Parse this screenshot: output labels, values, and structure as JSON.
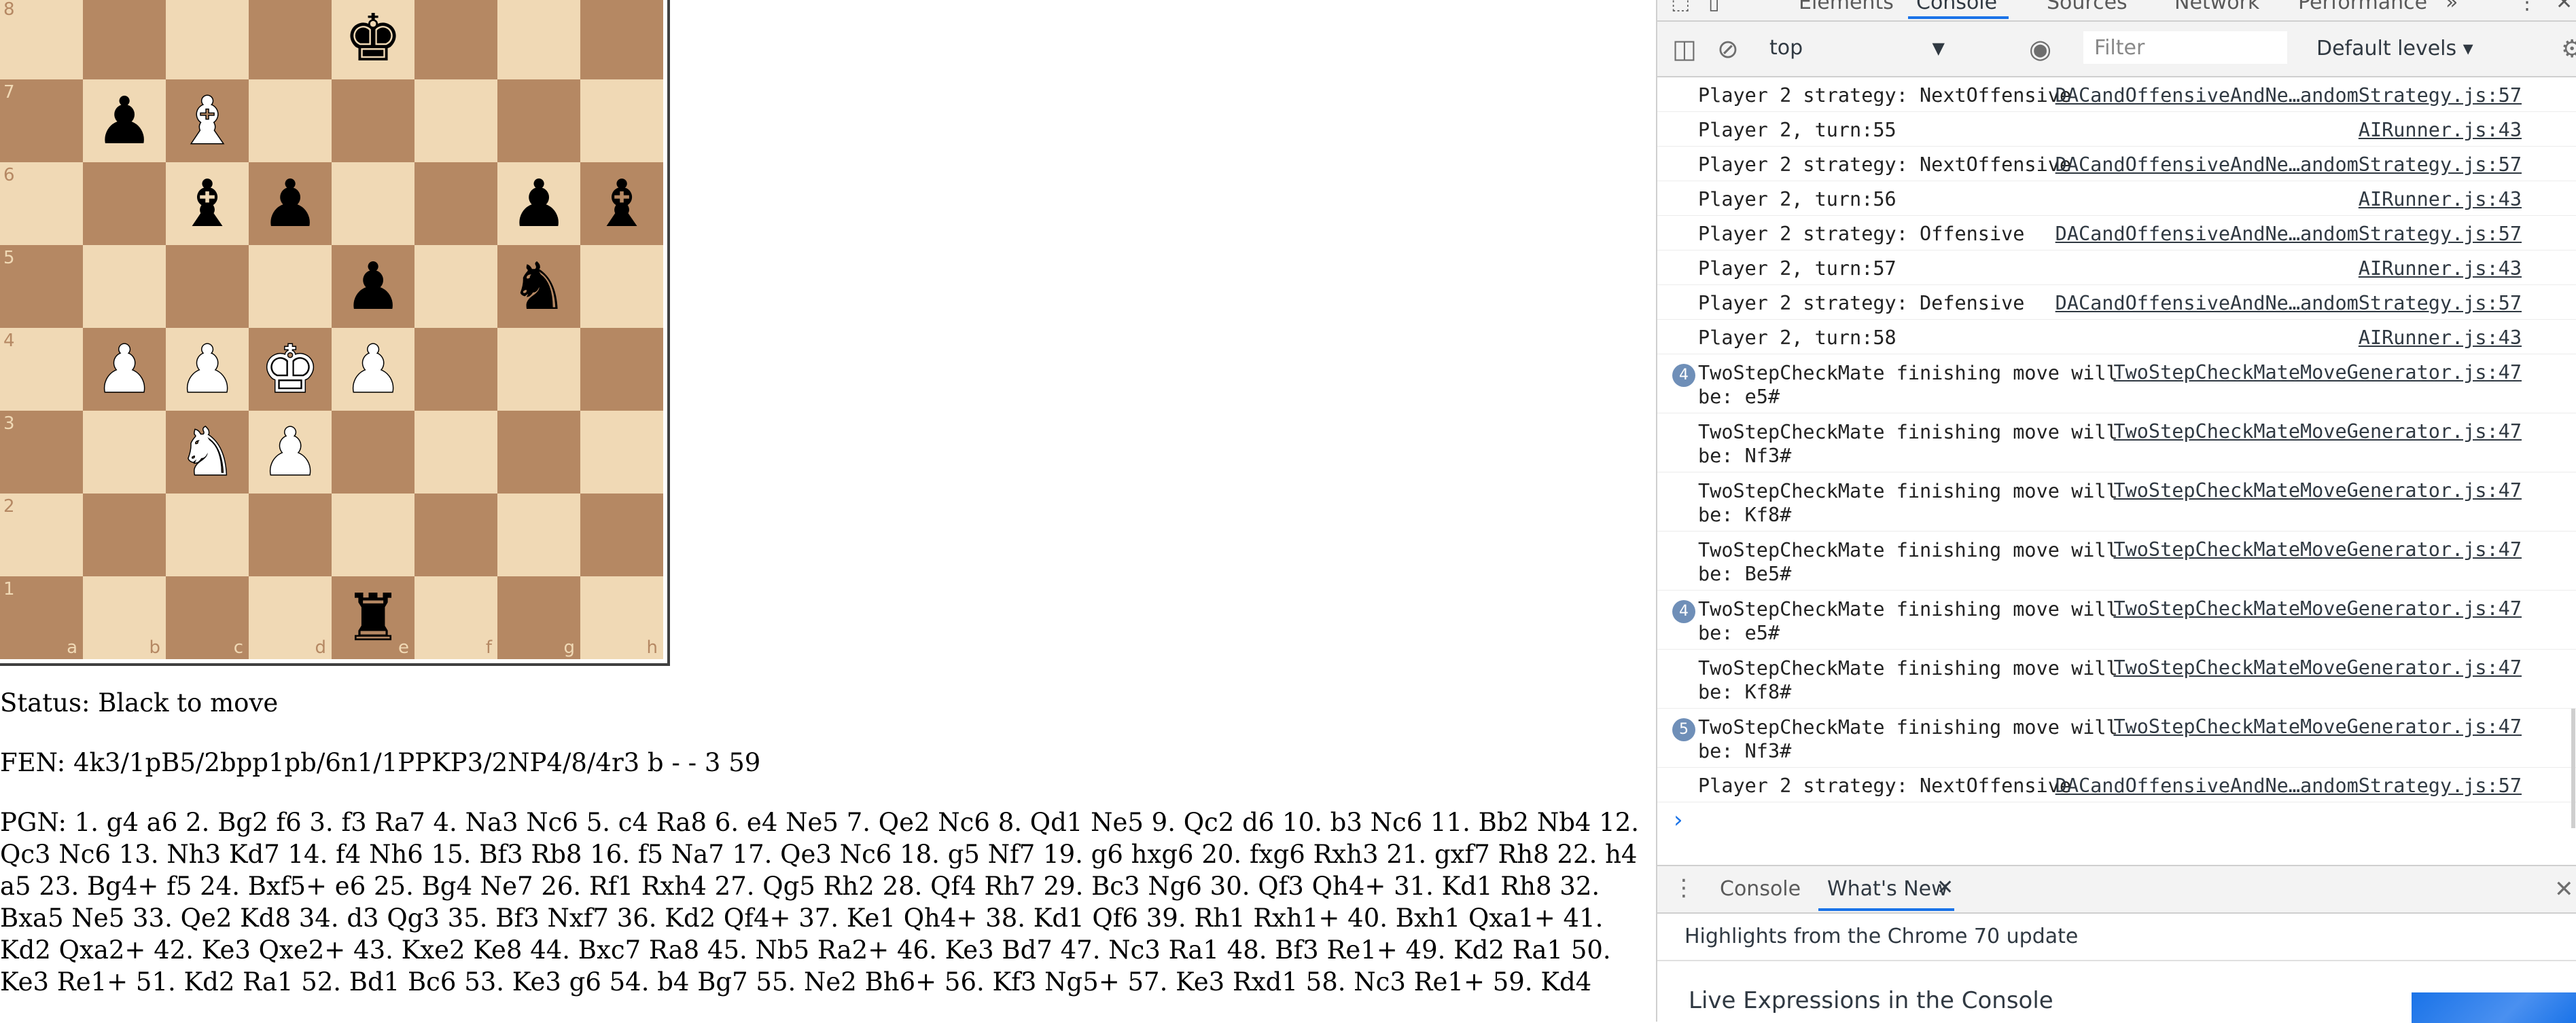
{
  "board": {
    "files": [
      "a",
      "b",
      "c",
      "d",
      "e",
      "f",
      "g",
      "h"
    ],
    "ranks": [
      "8",
      "7",
      "6",
      "5",
      "4",
      "3",
      "2",
      "1"
    ],
    "pieces": [
      {
        "square": "e8",
        "color": "black",
        "type": "king",
        "glyph": "♚"
      },
      {
        "square": "b7",
        "color": "black",
        "type": "pawn",
        "glyph": "♟"
      },
      {
        "square": "c7",
        "color": "white",
        "type": "bishop",
        "glyph": "♝"
      },
      {
        "square": "c6",
        "color": "black",
        "type": "bishop",
        "glyph": "♝"
      },
      {
        "square": "d6",
        "color": "black",
        "type": "pawn",
        "glyph": "♟"
      },
      {
        "square": "g6",
        "color": "black",
        "type": "pawn",
        "glyph": "♟"
      },
      {
        "square": "h6",
        "color": "black",
        "type": "bishop",
        "glyph": "♝"
      },
      {
        "square": "e5",
        "color": "black",
        "type": "pawn",
        "glyph": "♟"
      },
      {
        "square": "g5",
        "color": "black",
        "type": "knight",
        "glyph": "♞"
      },
      {
        "square": "b4",
        "color": "white",
        "type": "pawn",
        "glyph": "♟"
      },
      {
        "square": "c4",
        "color": "white",
        "type": "pawn",
        "glyph": "♟"
      },
      {
        "square": "d4",
        "color": "white",
        "type": "king",
        "glyph": "♚"
      },
      {
        "square": "e4",
        "color": "white",
        "type": "pawn",
        "glyph": "♟"
      },
      {
        "square": "c3",
        "color": "white",
        "type": "knight",
        "glyph": "♞"
      },
      {
        "square": "d3",
        "color": "white",
        "type": "pawn",
        "glyph": "♟"
      },
      {
        "square": "e1",
        "color": "black",
        "type": "rook",
        "glyph": "♜"
      }
    ],
    "light_color": "#f0d9b5",
    "dark_color": "#b58863"
  },
  "game": {
    "status": "Status: Black to move",
    "fen": "FEN: 4k3/1pB5/2bpp1pb/6n1/1PPKP3/2NP4/8/4r3 b - - 3 59",
    "pgn": "PGN: 1. g4 a6 2. Bg2 f6 3. f3 Ra7 4. Na3 Nc6 5. c4 Ra8 6. e4 Ne5 7. Qe2 Nc6 8. Qd1 Ne5 9. Qc2 d6 10. b3 Nc6 11. Bb2 Nb4 12. Qc3 Nc6 13. Nh3 Kd7 14. f4 Nh6 15. Bf3 Rb8 16. f5 Na7 17. Qe3 Nc6 18. g5 Nf7 19. g6 hxg6 20. fxg6 Rxh3 21. gxf7 Rh8 22. h4 a5 23. Bg4+ f5 24. Bxf5+ e6 25. Bg4 Ne7 26. Rf1 Rxh4 27. Qg5 Rh2 28. Qf4 Rh7 29. Bc3 Ng6 30. Qf3 Qh4+ 31. Kd1 Rh8 32. Bxa5 Ne5 33. Qe2 Kd8 34. d3 Qg3 35. Bf3 Nxf7 36. Kd2 Qf4+ 37. Ke1 Qh4+ 38. Kd1 Qf6 39. Rh1 Rxh1+ 40. Bxh1 Qxa1+ 41. Kd2 Qxa2+ 42. Ke3 Qxe2+ 43. Kxe2 Ke8 44. Bxc7 Ra8 45. Nb5 Ra2+ 46. Ke3 Bd7 47. Nc3 Ra1 48. Bf3 Re1+ 49. Kd2 Ra1 50. Ke3 Re1+ 51. Kd2 Ra1 52. Bd1 Bc6 53. Ke3 g6 54. b4 Bg7 55. Ne2 Bh6+ 56. Kf3 Ng5+ 57. Ke3 Rxd1 58. Nc3 Re1+ 59. Kd4"
  },
  "devtools": {
    "tabs": [
      {
        "label": "Elements",
        "active": false
      },
      {
        "label": "Console",
        "active": true
      },
      {
        "label": "Sources",
        "active": false
      },
      {
        "label": "Network",
        "active": false
      },
      {
        "label": "Performance",
        "active": false
      }
    ],
    "more_tabs_icon": "»",
    "menu_icon": "⋮",
    "close_icon": "✕",
    "toolbar": {
      "context": "top",
      "filter_placeholder": "Filter",
      "levels": "Default levels ▾"
    },
    "messages": [
      {
        "text": "Player 2 strategy: NextOffensive",
        "source": "DACandOffensiveAndNe…andomStrategy.js:57"
      },
      {
        "text": "Player 2, turn:55",
        "source": "AIRunner.js:43"
      },
      {
        "text": "Player 2 strategy: NextOffensive",
        "source": "DACandOffensiveAndNe…andomStrategy.js:57"
      },
      {
        "text": "Player 2, turn:56",
        "source": "AIRunner.js:43"
      },
      {
        "text": "Player 2 strategy: Offensive",
        "source": "DACandOffensiveAndNe…andomStrategy.js:57"
      },
      {
        "text": "Player 2, turn:57",
        "source": "AIRunner.js:43"
      },
      {
        "text": "Player 2 strategy: Defensive",
        "source": "DACandOffensiveAndNe…andomStrategy.js:57"
      },
      {
        "text": "Player 2, turn:58",
        "source": "AIRunner.js:43"
      },
      {
        "text": "TwoStepCheckMate finishing move will\nbe: e5#",
        "source": "TwoStepCheckMateMoveGenerator.js:47",
        "count": "4"
      },
      {
        "text": "TwoStepCheckMate finishing move will\nbe: Nf3#",
        "source": "TwoStepCheckMateMoveGenerator.js:47"
      },
      {
        "text": "TwoStepCheckMate finishing move will\nbe: Kf8#",
        "source": "TwoStepCheckMateMoveGenerator.js:47"
      },
      {
        "text": "TwoStepCheckMate finishing move will\nbe: Be5#",
        "source": "TwoStepCheckMateMoveGenerator.js:47"
      },
      {
        "text": "TwoStepCheckMate finishing move will\nbe: e5#",
        "source": "TwoStepCheckMateMoveGenerator.js:47",
        "count": "4"
      },
      {
        "text": "TwoStepCheckMate finishing move will\nbe: Kf8#",
        "source": "TwoStepCheckMateMoveGenerator.js:47"
      },
      {
        "text": "TwoStepCheckMate finishing move will\nbe: Nf3#",
        "source": "TwoStepCheckMateMoveGenerator.js:47",
        "count": "5"
      },
      {
        "text": "Player 2 strategy: NextOffensive",
        "source": "DACandOffensiveAndNe…andomStrategy.js:57"
      }
    ],
    "prompt": "›",
    "drawer": {
      "tabs": [
        {
          "label": "Console",
          "active": false
        },
        {
          "label": "What's New",
          "active": true
        }
      ],
      "tab_close": "✕",
      "highlights": "Highlights from the Chrome 70 update",
      "feature_title": "Live Expressions in the Console"
    }
  }
}
